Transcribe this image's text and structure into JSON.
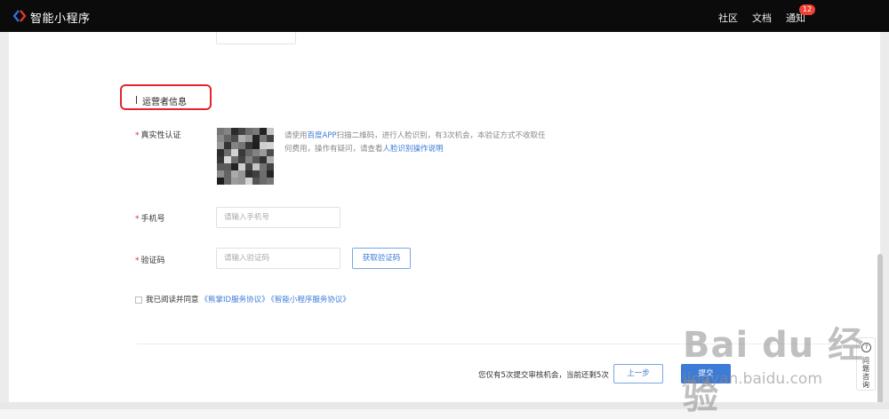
{
  "topbar": {
    "app_title": "智能小程序",
    "nav_community": "社区",
    "nav_docs": "文档",
    "nav_notify": "通知",
    "notify_count": "12",
    "logo_icon": "paddle-logo-icon"
  },
  "section": {
    "title": "运营者信息",
    "highlight_color": "#e5252b"
  },
  "form": {
    "verify_label": "真实性认证",
    "verify_desc_pre": "请使用",
    "verify_desc_link1": "百度APP",
    "verify_desc_mid": "扫描二维码，进行人脸识别，有3次机会，本验证方式不收取任何费用，操作有疑问，请查看",
    "verify_desc_link2": "人脸识别操作说明",
    "phone_label": "手机号",
    "phone_placeholder": "请输入手机号",
    "code_label": "验证码",
    "code_placeholder": "请输入验证码",
    "get_code_button": "获取验证码",
    "agree_text": "我已阅读并同意",
    "agree_link1": "《熊掌ID服务协议》",
    "agree_link2": "《智能小程序服务协议》"
  },
  "footer": {
    "submit_info": "您仅有5次提交审核机会，当前还剩5次",
    "prev_button": "上一步",
    "submit_button": "提交"
  },
  "help": {
    "label": "问题咨询",
    "icon": "question-circle-icon"
  },
  "watermark": {
    "main": "Bai du 经验",
    "sub": "jingyan.baidu.com"
  },
  "colors": {
    "accent": "#3c7bd6",
    "required": "#e5252b"
  }
}
